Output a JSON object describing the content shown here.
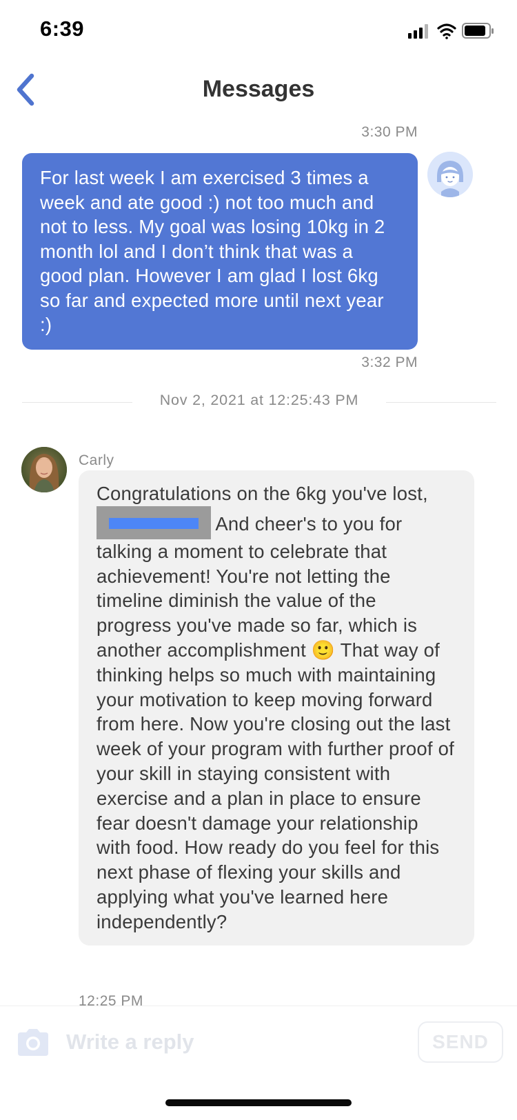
{
  "status_bar": {
    "time": "6:39",
    "icons": [
      "signal-icon",
      "wifi-icon",
      "battery-icon"
    ]
  },
  "header": {
    "title": "Messages",
    "back_icon": "chevron-left-icon"
  },
  "messages": [
    {
      "direction": "sent",
      "time_above": "3:30 PM",
      "text": "For last week I am exercised 3 times a week and ate good :) not too much and not to less. My goal was losing 10kg in 2 month lol and I don’t think that was a good plan. However I am glad I lost 6kg  so far and expected more until next year :)",
      "time_below": "3:32 PM"
    },
    {
      "direction": "received",
      "date_divider": "Nov 2, 2021 at 12:25:43 PM",
      "sender": "Carly",
      "text_before": "Congratulations on the 6kg you've lost, ",
      "text_after": " And cheer's to you for talking a moment to celebrate that achievement! You're not letting the timeline diminish the value of the progress you've made so far, which is another accomplishment 🙂 That way of thinking helps so much with maintaining your motivation to keep moving forward from here. Now you're closing out the last week of your program with further proof of your skill in staying consistent with exercise and a plan in place to ensure fear doesn't damage your relationship with food. How ready do you feel for this next phase of flexing your skills and applying what you've learned here independently?",
      "time_below": "12:25 PM"
    }
  ],
  "composer": {
    "camera_icon": "camera-icon",
    "placeholder": "Write a reply",
    "send_label": "SEND"
  },
  "colors": {
    "accent": "#4f74cf",
    "sent_bubble": "#5277d4",
    "received_bubble": "#f1f1f1",
    "muted_text": "#8a8a8a"
  }
}
